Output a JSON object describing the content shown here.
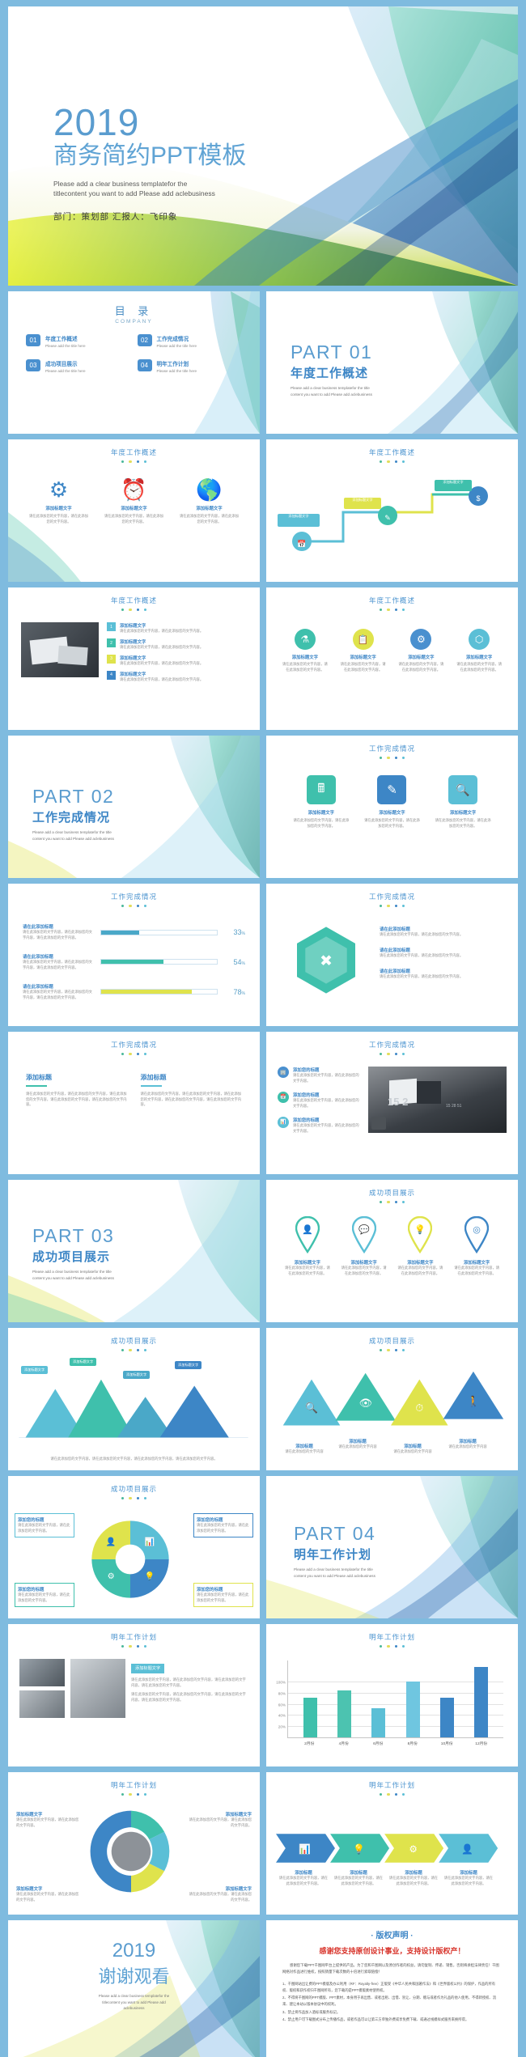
{
  "theme": {
    "page_bg": "#7fbbdf",
    "blue": "#4a90cf",
    "deep_blue": "#2f7fc1",
    "teal": "#3fc0ac",
    "green": "#5bc8a0",
    "yellow": "#dfe34c",
    "light_blue": "#6fc6e0",
    "red": "#d8342b",
    "dot_colors": [
      "#49b89a",
      "#e3dd5a",
      "#3d86c6",
      "#5bbfd6"
    ]
  },
  "cover": {
    "year": "2019",
    "title": "商务简约PPT模板",
    "subtitle_line1": "Please add a clear business templatefor the",
    "subtitle_line2": "titlecontent you want to add  Please add aclebusiness",
    "meta": "部门：策划部     汇报人：飞印象"
  },
  "toc": {
    "title": "目 录",
    "subtitle": "COMPANY",
    "items": [
      {
        "num": "01",
        "heading": "年度工作概述",
        "desc": "Please add the title here"
      },
      {
        "num": "02",
        "heading": "工作完成情况",
        "desc": "Please add the title here"
      },
      {
        "num": "03",
        "heading": "成功项目展示",
        "desc": "Please add the title here"
      },
      {
        "num": "04",
        "heading": "明年工作计划",
        "desc": "Please add the title here"
      }
    ]
  },
  "sections": [
    {
      "num": "PART 01",
      "cn": "年度工作概述",
      "en1": "Please add a clear business templatefor the title",
      "en2": "content you want to add  Please add aclebusiness"
    },
    {
      "num": "PART 02",
      "cn": "工作完成情况",
      "en1": "Please add a clear business templatefor the title",
      "en2": "content you want to add  Please add aclebusiness"
    },
    {
      "num": "PART 03",
      "cn": "成功项目展示",
      "en1": "Please add a clear business templatefor the title",
      "en2": "content you want to add  Please add aclebusiness"
    },
    {
      "num": "PART 04",
      "cn": "明年工作计划",
      "en1": "Please add a clear business templatefor the title",
      "en2": "content you want to add  Please add aclebusiness"
    }
  ],
  "headers": {
    "h1": "年度工作概述",
    "h2": "工作完成情况",
    "h3": "成功项目展示",
    "h4": "明年工作计划"
  },
  "placeholder": {
    "title": "添加标题文字",
    "title_alt": "请在此添加标题",
    "title_alt2": "添加你的标题",
    "body": "请在此添加您的文字内容，请在此添加您的文字内容。",
    "body_long": "请在此添加您的文字内容，请在此添加您的文字内容，请在此添加您的文字内容，请在此添加您的文字内容。"
  },
  "slide_icons": {
    "three_icons": [
      {
        "icon": "gear-icon",
        "glyph": "⚙",
        "color": "#3d86c6",
        "label": "添加标题文字",
        "desc": "请在此添加您的文字内容，请在此添加您的文字内容。"
      },
      {
        "icon": "alarm-clock-icon",
        "glyph": "⏰",
        "color": "#4aa8c8",
        "label": "添加标题文字",
        "desc": "请在此添加您的文字内容，请在此添加您的文字内容。"
      },
      {
        "icon": "globe-icon",
        "glyph": "🌐",
        "color": "#3fc0ac",
        "label": "添加标题文字",
        "desc": "请在此添加您的文字内容，请在此添加您的文字内容。"
      }
    ],
    "four_icons": [
      {
        "icon": "flask-icon",
        "glyph": "⚗",
        "color": "#3fc0ac",
        "label": "添加标题文字"
      },
      {
        "icon": "clipboard-icon",
        "glyph": "📋",
        "color": "#dfe34c",
        "label": "添加标题文字"
      },
      {
        "icon": "gear-icon",
        "glyph": "⚙",
        "color": "#4a90cf",
        "label": "添加标题文字"
      },
      {
        "icon": "dna-icon",
        "glyph": "⬡",
        "color": "#5bbfd6",
        "label": "添加标题文字"
      }
    ],
    "three_squares": [
      {
        "icon": "calculator-icon",
        "glyph": "🖩",
        "color": "#3fc0ac",
        "label": "添加标题文字"
      },
      {
        "icon": "edit-icon",
        "glyph": "✎",
        "color": "#3d86c6",
        "label": "添加标题文字"
      },
      {
        "icon": "search-doc-icon",
        "glyph": "🔍",
        "color": "#5bbfd6",
        "label": "添加标题文字"
      }
    ]
  },
  "timeline": {
    "steps": [
      {
        "label": "添加标题文字",
        "color": "#5bbfd6"
      },
      {
        "label": "添加标题文字",
        "color": "#dfe34c"
      },
      {
        "label": "添加标题文字",
        "color": "#3fc0ac"
      },
      {
        "label": "添加标题文字",
        "color": "#3d86c6"
      }
    ]
  },
  "list_slide": {
    "items": [
      {
        "num": "1",
        "title": "添加标题文字",
        "desc": "请在此添加您的文字内容，请在此添加您的文字内容。"
      },
      {
        "num": "2",
        "title": "添加标题文字",
        "desc": "请在此添加您的文字内容，请在此添加您的文字内容。"
      },
      {
        "num": "3",
        "title": "添加标题文字",
        "desc": "请在此添加您的文字内容，请在此添加您的文字内容。"
      },
      {
        "num": "4",
        "title": "添加标题文字",
        "desc": "请在此添加您的文字内容，请在此添加您的文字内容。"
      }
    ]
  },
  "progress_slide": {
    "rows": [
      {
        "title": "请在此添加标题",
        "desc": "请在此添加您的文字内容，请在此添加您的文字内容，请在此添加您的文字内容。",
        "pct": 33,
        "color": "#4aa8c8"
      },
      {
        "title": "请在此添加标题",
        "desc": "请在此添加您的文字内容，请在此添加您的文字内容，请在此添加您的文字内容。",
        "pct": 54,
        "color": "#3fc0ac"
      },
      {
        "title": "请在此添加标题",
        "desc": "请在此添加您的文字内容，请在此添加您的文字内容，请在此添加您的文字内容。",
        "pct": 78,
        "color": "#dfe34c"
      }
    ]
  },
  "hex_slide": {
    "points": [
      {
        "title": "请在此添加标题",
        "desc": "请在此添加您的文字内容，请在此添加您的文字内容。"
      },
      {
        "title": "请在此添加标题",
        "desc": "请在此添加您的文字内容，请在此添加您的文字内容。"
      },
      {
        "title": "请在此添加标题",
        "desc": "请在此添加您的文字内容，请在此添加您的文字内容。"
      }
    ]
  },
  "two_col_slide": {
    "left_title": "添加标题",
    "right_title": "添加标题",
    "left_body": "请在此添加您的文字内容，请在此添加您的文字内容，请在此添加您的文字内容，请在此添加您的文字内容，请在此添加您的文字内容。",
    "right_body": "请在此添加您的文字内容，请在此添加您的文字内容，请在此添加您的文字内容，请在此添加您的文字内容，请在此添加您的文字内容。"
  },
  "photo_slide": {
    "bullets": [
      {
        "icon": "building-icon",
        "glyph": "🏢",
        "color": "#4a90cf",
        "title": "添加您的标题",
        "desc": "请在此添加您的文字内容，请在此添加您的文字内容。"
      },
      {
        "icon": "calendar-icon",
        "glyph": "📅",
        "color": "#3fc0ac",
        "title": "添加您的标题",
        "desc": "请在此添加您的文字内容，请在此添加您的文字内容。"
      },
      {
        "icon": "chart-icon",
        "glyph": "📊",
        "color": "#5bbfd6",
        "title": "添加您的标题",
        "desc": "请在此添加您的文字内容，请在此添加您的文字内容。"
      }
    ],
    "photo_caption": "15 2",
    "photo_sub": "15 28 51"
  },
  "pins_slide": {
    "pins": [
      {
        "icon": "user-icon",
        "glyph": "👤",
        "color": "#3fc0ac",
        "label": "添加标题文字"
      },
      {
        "icon": "chat-icon",
        "glyph": "💬",
        "color": "#5bbfd6",
        "label": "添加标题文字"
      },
      {
        "icon": "lightbulb-icon",
        "glyph": "💡",
        "color": "#dfe34c",
        "label": "添加标题文字"
      },
      {
        "icon": "target-icon",
        "glyph": "◎",
        "color": "#3d86c6",
        "label": "添加标题文字"
      }
    ]
  },
  "mountain_slide": {
    "peaks": [
      {
        "label": "添加标题文字",
        "color": "#5bbfd6",
        "h": 48
      },
      {
        "label": "添加标题文字",
        "color": "#3fc0ac",
        "h": 62
      },
      {
        "label": "添加标题文字",
        "color": "#4aa8c8",
        "h": 40
      },
      {
        "label": "添加标题文字",
        "color": "#3d86c6",
        "h": 56
      }
    ],
    "caption": "请在此添加您的文字内容，请在此添加您的文字内容，请在此添加您的文字内容，请在此添加您的文字内容。"
  },
  "triangles_slide": {
    "items": [
      {
        "icon": "search-icon",
        "glyph": "🔍",
        "color": "#5bbfd6",
        "label": "添加标题",
        "desc": "请在此添加您的文字内容"
      },
      {
        "icon": "eye-icon",
        "glyph": "👁",
        "color": "#3fc0ac",
        "label": "添加标题",
        "desc": "请在此添加您的文字内容"
      },
      {
        "icon": "clock-icon",
        "glyph": "⏱",
        "color": "#dfe34c",
        "label": "添加标题",
        "desc": "请在此添加您的文字内容"
      },
      {
        "icon": "person-icon",
        "glyph": "🚶",
        "color": "#3d86c6",
        "label": "添加标题",
        "desc": "请在此添加您的文字内容"
      }
    ]
  },
  "pie_slide": {
    "boxes": [
      {
        "label": "添加您的标题",
        "color": "#5bbfd6"
      },
      {
        "label": "添加您的标题",
        "color": "#3d86c6"
      },
      {
        "label": "添加您的标题",
        "color": "#3fc0ac"
      },
      {
        "label": "添加您的标题",
        "color": "#dfe34c"
      }
    ]
  },
  "cycle_slide": {
    "labels": [
      {
        "text": "添加标题文字",
        "color": "#3fc0ac"
      },
      {
        "text": "添加标题文字",
        "color": "#5bbfd6"
      },
      {
        "text": "添加标题文字",
        "color": "#dfe34c"
      },
      {
        "text": "添加标题文字",
        "color": "#3d86c6"
      }
    ]
  },
  "arrows_slide": {
    "steps": [
      {
        "icon": "chart-bar-icon",
        "glyph": "📊",
        "color": "#3d86c6",
        "label": "添加标题"
      },
      {
        "icon": "lightbulb-icon",
        "glyph": "💡",
        "color": "#3fc0ac",
        "label": "添加标题"
      },
      {
        "icon": "gear-icon",
        "glyph": "⚙",
        "color": "#dfe34c",
        "label": "添加标题"
      },
      {
        "icon": "person-icon",
        "glyph": "👤",
        "color": "#5bbfd6",
        "label": "添加标题"
      }
    ]
  },
  "chart_data": {
    "type": "bar",
    "title": "明年工作计划",
    "categories": [
      "2月份",
      "4月份",
      "6月份",
      "8月份",
      "10月份",
      "12月份"
    ],
    "values": [
      72,
      86,
      54,
      102,
      72,
      128
    ],
    "colors": [
      "#3fc0ac",
      "#4cc3b0",
      "#5bbfd6",
      "#6fc6e0",
      "#3d86c6",
      "#3d86c6"
    ],
    "yticks": [
      "20%",
      "40%",
      "60%",
      "80%",
      "100%"
    ],
    "ytick_values": [
      20,
      40,
      60,
      80,
      100
    ],
    "ylim": [
      0,
      140
    ],
    "xlabel": "",
    "ylabel": "",
    "grid": true,
    "legend": false
  },
  "thanks": {
    "year": "2019",
    "title": "谢谢观看",
    "line1": "Please add a clear business templatefor the",
    "line2": "titlecontent you want to add  Please add",
    "line3": "aclebusiness"
  },
  "copyright": {
    "heading": "· 版权声明 ·",
    "title": "感谢您支持原创设计事业，支持设计版权产！",
    "lead": "感谢您下载PPT千图网平台上提供的产品，为了您和千图网以及原创作者的权益，请勿复制、传递、销售，否则将承担法律责任！千图网络对作品进行维权，按照销量下载次数的十倍进行索取赔偿！",
    "items": [
      "1、千图网站出让费的PPT模版及办公利用（RF：Royalty-free）正版受《中华人民共和国著作法》和《世界版权公约》的保护，作品的所有权、版权和获作权归千图网所有，您下载的是PPT模版素材使用权。",
      "2、不得将千图网的PPT模版、PPT素材，本身用于再出售、或者出租、出借、别让、分期、赠与或者作为礼品的他人使用，不得转授权、流来、建让本站以版本协议中的权利。",
      "3、禁止将作品加入酒标或服务标记。",
      "4、禁止用户可下载图式分布上传播作品，或者作品可以让第三方单独外费或享免费下载、或通过线模样式服务来换所得。"
    ]
  }
}
